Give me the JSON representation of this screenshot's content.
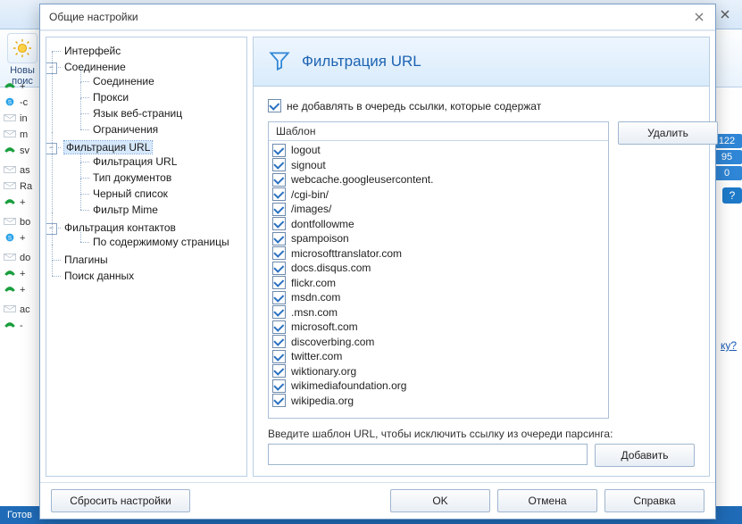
{
  "app": {
    "toolbar": {
      "new_search_line1": "Новы",
      "new_search_line2": "поис"
    },
    "side_rows": [
      {
        "icon": "phone",
        "text": "+"
      },
      {
        "icon": "skype",
        "text": "-с"
      },
      {
        "icon": "env",
        "text": "in"
      },
      {
        "icon": "env",
        "text": "m"
      },
      {
        "icon": "phone",
        "text": "sv"
      },
      {
        "icon": "blank",
        "text": ""
      },
      {
        "icon": "env",
        "text": "as"
      },
      {
        "icon": "env",
        "text": "Ra"
      },
      {
        "icon": "phone",
        "text": "+"
      },
      {
        "icon": "blank",
        "text": ""
      },
      {
        "icon": "env",
        "text": "bo"
      },
      {
        "icon": "skype",
        "text": "+"
      },
      {
        "icon": "blank",
        "text": ""
      },
      {
        "icon": "env",
        "text": "do"
      },
      {
        "icon": "phone",
        "text": "+"
      },
      {
        "icon": "phone",
        "text": "+"
      },
      {
        "icon": "blank",
        "text": ""
      },
      {
        "icon": "env",
        "text": "ac"
      },
      {
        "icon": "phone",
        "text": "-"
      }
    ],
    "stats": {
      "a": "122",
      "b": "95",
      "c": "0"
    },
    "link": "ку?",
    "status": "Готов"
  },
  "dialog": {
    "title": "Общие настройки",
    "tree": {
      "interface": "Интерфейс",
      "connection": "Соединение",
      "connection_sub": "Соединение",
      "proxy": "Прокси",
      "lang": "Язык веб-страниц",
      "limits": "Ограничения",
      "urlfilter": "Фильтрация URL",
      "urlfilter_sub": "Фильтрация URL",
      "doctype": "Тип документов",
      "blacklist": "Черный список",
      "mime": "Фильтр Mime",
      "contactfilter": "Фильтрация контактов",
      "bycontent": "По содержимому страницы",
      "plugins": "Плагины",
      "datasearch": "Поиск данных"
    },
    "panel": {
      "title": "Фильтрация URL",
      "checkbox_label": "не добавлять в очередь ссылки, которые содержат",
      "checkbox_checked": true,
      "column_header": "Шаблон",
      "delete_btn": "Удалить",
      "items": [
        "logout",
        "signout",
        "webcache.googleusercontent.",
        "/cgi-bin/",
        "/images/",
        "dontfollowme",
        "spampoison",
        "microsofttranslator.com",
        "docs.disqus.com",
        "flickr.com",
        "msdn.com",
        ".msn.com",
        "microsoft.com",
        "discoverbing.com",
        "twitter.com",
        "wiktionary.org",
        "wikimediafoundation.org",
        "wikipedia.org"
      ],
      "hint": "Введите шаблон URL, чтобы исключить ссылку из очереди парсинга:",
      "add_btn": "Добавить",
      "input_value": ""
    },
    "footer": {
      "reset": "Сбросить настройки",
      "ok": "OK",
      "cancel": "Отмена",
      "help": "Справка"
    }
  }
}
